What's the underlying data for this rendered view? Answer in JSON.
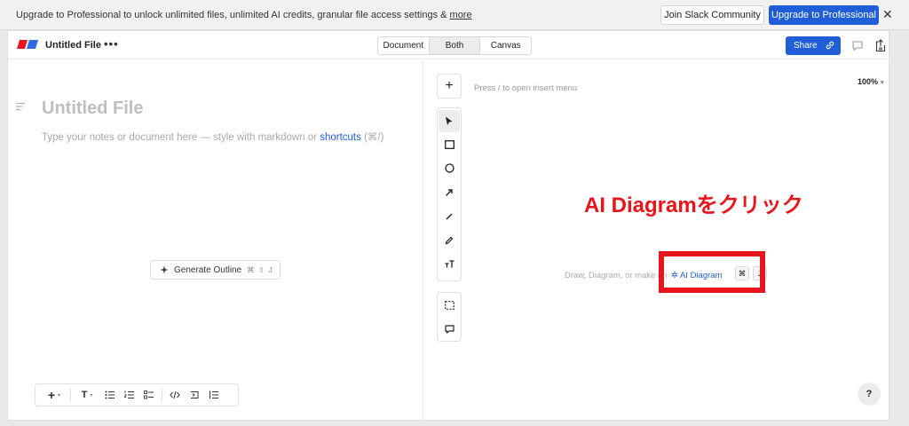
{
  "banner": {
    "text": "Upgrade to Professional to unlock unlimited files, unlimited AI credits, granular file access settings & ",
    "more_link": "more",
    "join_slack": "Join Slack Community",
    "upgrade": "Upgrade to Professional",
    "close": "✕"
  },
  "topbar": {
    "file_title": "Untitled File",
    "more": "•••",
    "tabs": [
      {
        "label": "Document",
        "active": false
      },
      {
        "label": "Both",
        "active": true
      },
      {
        "label": "Canvas",
        "active": false
      }
    ],
    "share": "Share"
  },
  "document": {
    "title_placeholder": "Untitled File",
    "body_placeholder_before": "Type your notes or document here — style with markdown or ",
    "body_placeholder_link": "shortcuts",
    "body_placeholder_after": " (⌘/)",
    "generate_outline": "Generate Outline",
    "generate_outline_shortcut": "⌘ ⇧ J",
    "toolbar": {
      "insert": "+",
      "insert_caret": "▾",
      "text_style": "T",
      "text_style_caret": "▾"
    }
  },
  "canvas": {
    "plus": "+",
    "insert_hint": "Press / to open insert menu",
    "zoom": "100%",
    "zoom_caret": "▾",
    "hint_text": "Draw, Diagram, or make an",
    "ai_diagram": "AI Diagram",
    "ai_diagram_sparkle": "✲",
    "kbd_cmd": "⌘",
    "kbd_j": "J",
    "annotation": "AI Diagramをクリック",
    "help": "?"
  },
  "colors": {
    "brand_blue": "#1f5ed6",
    "annotation_red": "#e8161c",
    "logo_red": "#e8161c",
    "logo_blue": "#2e6be6"
  }
}
